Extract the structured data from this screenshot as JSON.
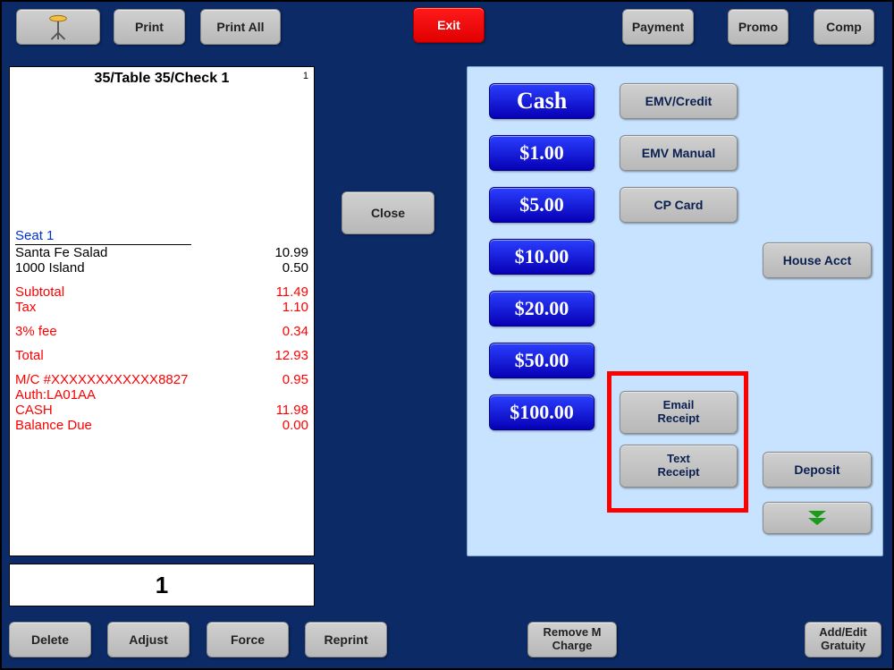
{
  "toolbar": {
    "print": "Print",
    "printall": "Print All",
    "exit": "Exit",
    "payment": "Payment",
    "promo": "Promo",
    "comp": "Comp"
  },
  "close_label": "Close",
  "receipt": {
    "title": "35/Table 35/Check 1",
    "header_num": "1",
    "seat_label": "Seat 1",
    "items": [
      {
        "name": "Santa Fe Salad",
        "price": "10.99"
      },
      {
        "name": " 1000 Island",
        "price": "0.50"
      }
    ],
    "subtotal_label": "Subtotal",
    "subtotal": "11.49",
    "tax_label": "Tax",
    "tax": "1.10",
    "fee_label": "3% fee",
    "fee": "0.34",
    "total_label": "Total",
    "total": "12.93",
    "cc_line": "M/C #XXXXXXXXXXXX8827",
    "cc_amt": "0.95",
    "auth_line": " Auth:LA01AA",
    "cash_label": "CASH",
    "cash": "11.98",
    "balance_label": "Balance Due",
    "balance": "0.00"
  },
  "qty": "1",
  "bottom": {
    "delete": "Delete",
    "adjust": "Adjust",
    "force": "Force",
    "reprint": "Reprint",
    "removem": "Remove M Charge",
    "addedit": "Add/Edit Gratuity"
  },
  "cashbtns": {
    "cash": "Cash",
    "d1": "$1.00",
    "d5": "$5.00",
    "d10": "$10.00",
    "d20": "$20.00",
    "d50": "$50.00",
    "d100": "$100.00"
  },
  "midbtns": {
    "emvcredit": "EMV/Credit",
    "emvmanual": "EMV Manual",
    "cpcard": "CP Card",
    "emailrcpt": "Email\nReceipt",
    "textrcpt": "Text\nReceipt"
  },
  "rightbtns": {
    "houseacct": "House Acct",
    "deposit": "Deposit"
  }
}
